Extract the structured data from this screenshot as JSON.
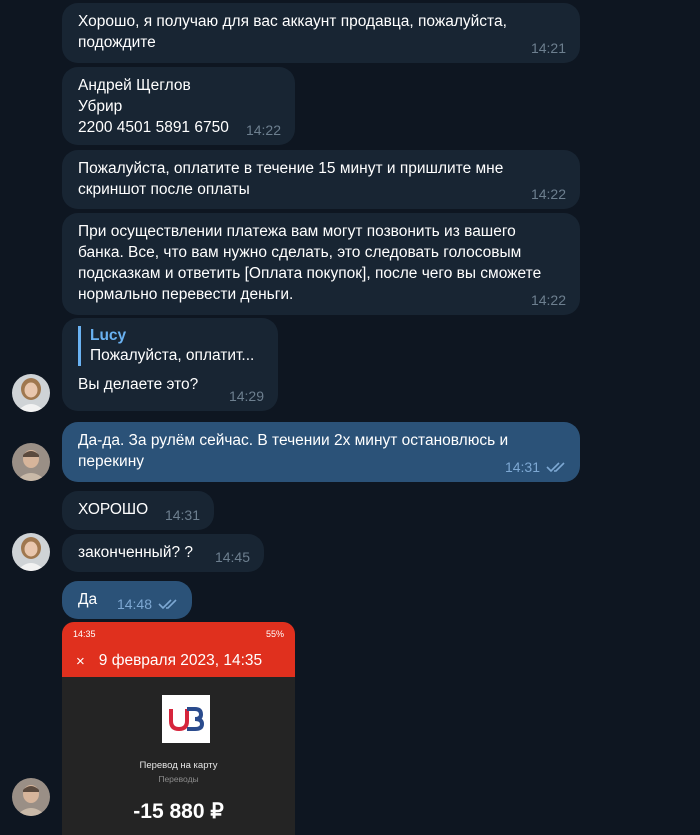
{
  "messages": [
    {
      "text": "Хорошо, я получаю для вас аккаунт продавца, пожалуйста,\nподождите",
      "time": "14:21"
    },
    {
      "text": "Андрей Щеглов\nУбрир\n2200 4501 5891 6750",
      "time": "14:22"
    },
    {
      "text": "Пожалуйста, оплатите в течение 15 минут и пришлите мне\nскриншот после оплаты",
      "time": "14:22"
    },
    {
      "text": "При осуществлении платежа вам могут позвонить из вашего\nбанка. Все, что вам нужно сделать, это следовать голосовым\nподсказкам и ответить [Оплата покупок], после чего вы сможете\nнормально перевести деньги.",
      "time": "14:22"
    },
    {
      "reply_name": "Lucy",
      "reply_text": "Пожалуйста, оплатит...",
      "text": "Вы делаете это?",
      "time": "14:29"
    },
    {
      "text": "Да-да. За рулём сейчас. В течении 2х минут остановлюсь и\nперекину",
      "time": "14:31"
    },
    {
      "text": "ХОРОШО",
      "time": "14:31"
    },
    {
      "text": "законченный? ?",
      "time": "14:45"
    },
    {
      "text": "Да",
      "time": "14:48"
    }
  ],
  "screenshot": {
    "status_time": "14:35",
    "status_right": "55%",
    "header_date": "9 февраля 2023, 14:35",
    "close_symbol": "×",
    "logo_text": "UB",
    "title": "Перевод на карту",
    "subtitle": "Переводы",
    "amount": "-15 880 ₽"
  },
  "colors": {
    "background": "#0e1621",
    "incoming_bubble": "#182533",
    "outgoing_bubble": "#2b5278",
    "accent": "#6ab2f2",
    "header_red": "#e0301e"
  }
}
